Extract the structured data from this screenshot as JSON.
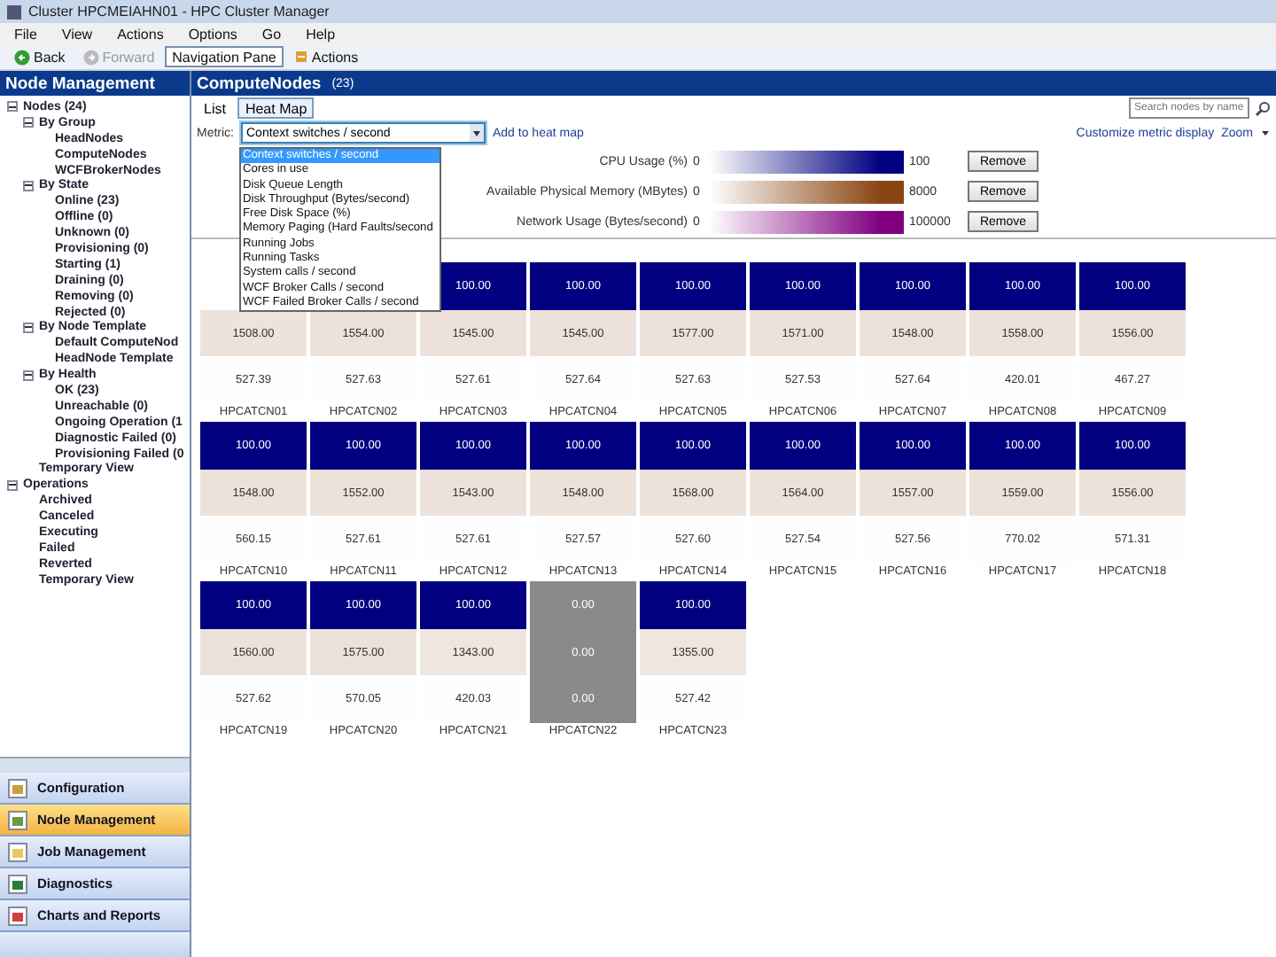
{
  "window": {
    "title": "Cluster HPCMEIAHN01 - HPC Cluster Manager"
  },
  "menu": [
    "File",
    "View",
    "Actions",
    "Options",
    "Go",
    "Help"
  ],
  "toolbar": [
    {
      "label": "Back",
      "kind": "back",
      "disabled": false
    },
    {
      "label": "Forward",
      "kind": "forward",
      "disabled": true
    },
    {
      "label": "Navigation Pane",
      "kind": "toggle",
      "disabled": false
    },
    {
      "label": "Actions",
      "kind": "actions",
      "disabled": false
    }
  ],
  "left_pane": {
    "title": "Node Management",
    "tree": [
      {
        "label": "Nodes (24)",
        "expanded": true,
        "children": [
          {
            "label": "By Group",
            "expanded": true,
            "children": [
              {
                "label": "HeadNodes"
              },
              {
                "label": "ComputeNodes"
              },
              {
                "label": "WCFBrokerNodes"
              }
            ]
          },
          {
            "label": "By State",
            "expanded": true,
            "children": [
              {
                "label": "Online (23)"
              },
              {
                "label": "Offline (0)"
              },
              {
                "label": "Unknown (0)"
              },
              {
                "label": "Provisioning (0)"
              },
              {
                "label": "Starting (1)"
              },
              {
                "label": "Draining (0)"
              },
              {
                "label": "Removing (0)"
              },
              {
                "label": "Rejected (0)"
              }
            ]
          },
          {
            "label": "By Node Template",
            "expanded": true,
            "children": [
              {
                "label": "Default ComputeNod"
              },
              {
                "label": "HeadNode Template"
              }
            ]
          },
          {
            "label": "By Health",
            "expanded": true,
            "children": [
              {
                "label": "OK (23)"
              },
              {
                "label": "Unreachable (0)"
              },
              {
                "label": "Ongoing Operation (1"
              },
              {
                "label": "Diagnostic Failed (0)"
              },
              {
                "label": "Provisioning Failed (0"
              }
            ]
          },
          {
            "label": "Temporary View"
          }
        ]
      },
      {
        "label": "Operations",
        "expanded": true,
        "children": [
          {
            "label": "Archived"
          },
          {
            "label": "Canceled"
          },
          {
            "label": "Executing"
          },
          {
            "label": "Failed"
          },
          {
            "label": "Reverted"
          },
          {
            "label": "Temporary View"
          }
        ]
      }
    ]
  },
  "nav_buttons": [
    {
      "label": "Configuration",
      "kind": "configuration",
      "selected": false
    },
    {
      "label": "Node Management",
      "kind": "nodes",
      "selected": true
    },
    {
      "label": "Job Management",
      "kind": "jobs",
      "selected": false
    },
    {
      "label": "Diagnostics",
      "kind": "diagnostics",
      "selected": false
    },
    {
      "label": "Charts and Reports",
      "kind": "charts",
      "selected": false
    }
  ],
  "content": {
    "title": "ComputeNodes",
    "count": "(23)",
    "search": {
      "placeholder": "Search nodes by name"
    },
    "view_tabs": [
      {
        "label": "List",
        "selected": false
      },
      {
        "label": "Heat Map",
        "selected": true
      }
    ],
    "customize_link": "Customize metric display",
    "zoom": "Zoom",
    "metric": {
      "label": "Metric:",
      "value": "Context switches / second",
      "add_link": "Add to heat map",
      "expanded": true,
      "options": [
        {
          "label": "Context switches / second",
          "selected": true
        },
        {
          "label": "Cores in use",
          "selected": false
        },
        {
          "label": "Disk Queue Length",
          "selected": false
        },
        {
          "label": "Disk Throughput (Bytes/second)",
          "selected": false
        },
        {
          "label": "Free Disk Space (%)",
          "selected": false
        },
        {
          "label": "Memory Paging (Hard Faults/second",
          "selected": false
        },
        {
          "label": "Running Jobs",
          "selected": false
        },
        {
          "label": "Running Tasks",
          "selected": false
        },
        {
          "label": "System calls / second",
          "selected": false
        },
        {
          "label": "WCF Broker Calls / second",
          "selected": false
        },
        {
          "label": "WCF Failed Broker Calls / second",
          "selected": false
        }
      ]
    },
    "legend": [
      {
        "label": "CPU Usage (%)",
        "min": "0",
        "max": "100",
        "color": "#000080",
        "button": "Remove"
      },
      {
        "label": "Available Physical Memory (MBytes)",
        "min": "0",
        "max": "8000",
        "color": "#8b4513",
        "button": "Remove"
      },
      {
        "label": "Network Usage (Bytes/second)",
        "min": "0",
        "max": "100000",
        "color": "#800080",
        "button": "Remove"
      }
    ],
    "nodes": [
      {
        "name": "HPCATCN01",
        "offline": false,
        "memory": "1508.00",
        "network": "527.39"
      },
      {
        "name": "HPCATCN02",
        "offline": false,
        "memory": "1554.00",
        "network": "527.63"
      },
      {
        "name": "HPCATCN03",
        "offline": false,
        "cpu": "100.00",
        "memory": "1545.00",
        "network": "527.61"
      },
      {
        "name": "HPCATCN04",
        "offline": false,
        "cpu": "100.00",
        "memory": "1545.00",
        "network": "527.64"
      },
      {
        "name": "HPCATCN05",
        "offline": false,
        "cpu": "100.00",
        "memory": "1577.00",
        "network": "527.63"
      },
      {
        "name": "HPCATCN06",
        "offline": false,
        "cpu": "100.00",
        "memory": "1571.00",
        "network": "527.53"
      },
      {
        "name": "HPCATCN07",
        "offline": false,
        "cpu": "100.00",
        "memory": "1548.00",
        "network": "527.64"
      },
      {
        "name": "HPCATCN08",
        "offline": false,
        "cpu": "100.00",
        "memory": "1558.00",
        "network": "420.01"
      },
      {
        "name": "HPCATCN09",
        "offline": false,
        "cpu": "100.00",
        "memory": "1556.00",
        "network": "467.27"
      },
      {
        "name": "HPCATCN10",
        "offline": false,
        "cpu": "100.00",
        "memory": "1548.00",
        "network": "560.15"
      },
      {
        "name": "HPCATCN11",
        "offline": false,
        "cpu": "100.00",
        "memory": "1552.00",
        "network": "527.61"
      },
      {
        "name": "HPCATCN12",
        "offline": false,
        "cpu": "100.00",
        "memory": "1543.00",
        "network": "527.61"
      },
      {
        "name": "HPCATCN13",
        "offline": false,
        "cpu": "100.00",
        "memory": "1548.00",
        "network": "527.57"
      },
      {
        "name": "HPCATCN14",
        "offline": false,
        "cpu": "100.00",
        "memory": "1568.00",
        "network": "527.60"
      },
      {
        "name": "HPCATCN15",
        "offline": false,
        "cpu": "100.00",
        "memory": "1564.00",
        "network": "527.54"
      },
      {
        "name": "HPCATCN16",
        "offline": false,
        "cpu": "100.00",
        "memory": "1557.00",
        "network": "527.56"
      },
      {
        "name": "HPCATCN17",
        "offline": false,
        "cpu": "100.00",
        "memory": "1559.00",
        "network": "770.02"
      },
      {
        "name": "HPCATCN18",
        "offline": false,
        "cpu": "100.00",
        "memory": "1556.00",
        "network": "571.31"
      },
      {
        "name": "HPCATCN19",
        "offline": false,
        "cpu": "100.00",
        "memory": "1560.00",
        "network": "527.62"
      },
      {
        "name": "HPCATCN20",
        "offline": false,
        "cpu": "100.00",
        "memory": "1575.00",
        "network": "570.05"
      },
      {
        "name": "HPCATCN21",
        "offline": false,
        "cpu": "100.00",
        "memory": "1343.00",
        "network": "420.03"
      },
      {
        "name": "HPCATCN22",
        "offline": true,
        "cpu": "0.00",
        "memory": "0.00",
        "network": "0.00"
      },
      {
        "name": "HPCATCN23",
        "offline": false,
        "cpu": "100.00",
        "memory": "1355.00",
        "network": "527.42"
      }
    ]
  }
}
